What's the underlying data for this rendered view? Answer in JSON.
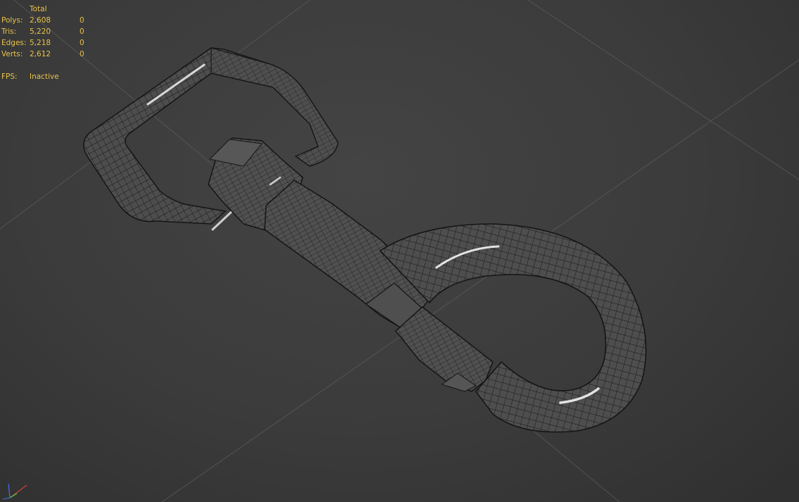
{
  "viewport": {
    "stats": {
      "header": "Total",
      "rows": [
        {
          "label": "Polys:",
          "total": "2,608",
          "selected": "0"
        },
        {
          "label": "Tris:",
          "total": "5,220",
          "selected": "0"
        },
        {
          "label": "Edges:",
          "total": "5,218",
          "selected": "0"
        },
        {
          "label": "Verts:",
          "total": "2,612",
          "selected": "0"
        }
      ],
      "fps_label": "FPS:",
      "fps_value": "Inactive"
    },
    "gizmo": {
      "axes": [
        {
          "name": "x",
          "color": "#d23c3c"
        },
        {
          "name": "y",
          "color": "#3ccf3c"
        },
        {
          "name": "z",
          "color": "#3c6fe0"
        }
      ]
    },
    "model": {
      "name": "swivel-snap-hook",
      "wire_color": "#1b1b1b",
      "surface_color": "#4a4a4a",
      "highlight_color": "#ffffff"
    },
    "text_color": "#e8c24a"
  }
}
